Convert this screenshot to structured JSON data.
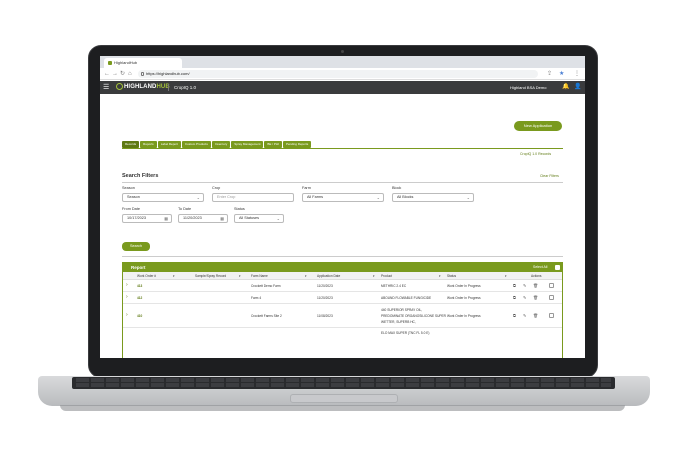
{
  "browser": {
    "tab_title": "HighlandHub",
    "url": "https://highlandhub.com/",
    "nav_icons": [
      "back-icon",
      "forward-icon",
      "reload-icon",
      "home-icon"
    ]
  },
  "header": {
    "logo_main": "HIGHLAND",
    "logo_accent": "HUB",
    "app_title": "CropIQ 1.0",
    "user": "Highland BSA Demo"
  },
  "toolbar": {
    "new_application": "New Application",
    "cropiq_label": "CropIQ 1.0 Records"
  },
  "tabs": [
    {
      "label": "Records",
      "active": true
    },
    {
      "label": "Reports",
      "active": false
    },
    {
      "label": "Label Report",
      "active": false
    },
    {
      "label": "Custom Products",
      "active": false
    },
    {
      "label": "Inventory",
      "active": false
    },
    {
      "label": "Spray Management",
      "active": false
    },
    {
      "label": "BE / PHI",
      "active": false
    },
    {
      "label": "Pending Reports",
      "active": false
    }
  ],
  "filters": {
    "title": "Search Filters",
    "clear": "Clear Filters",
    "season_label": "Season",
    "season_value": "Season",
    "crop_label": "Crop",
    "crop_placeholder": "Enter Crop",
    "farm_label": "Farm",
    "farm_value": "All Farms",
    "block_label": "Block",
    "block_value": "All Blocks",
    "from_label": "From Date",
    "from_value": "10/17/2023",
    "to_label": "To Date",
    "to_value": "11/20/2023",
    "status_label": "Status",
    "status_value": "All Statuses",
    "search_button": "Search"
  },
  "report": {
    "title": "Report",
    "select_all": "Select All",
    "columns": [
      "Work Order #",
      "Sample/Spray Record",
      "Farm Name",
      "Application Date",
      "Product",
      "Status",
      "Actions"
    ],
    "rows": [
      {
        "wo": "413",
        "farm": "Crockett Demo Farm",
        "date": "11/20/2023",
        "product": [
          "METHRIC 2.4 EC"
        ],
        "status": "Work Order In Progress"
      },
      {
        "wo": "412",
        "farm": "Farm 4",
        "date": "11/20/2023",
        "product": [
          "ABOUND FLOWABLE FUNGICIDE"
        ],
        "status": "Work Order In Progress"
      },
      {
        "wo": "410",
        "farm": "Crockett Farms Site 2",
        "date": "11/08/2023",
        "product": [
          "440 SUPERIOR SPRAY OIL,",
          "PREDOMINATE ORGANOSILICONE SUPER",
          "WETTER, SUPERB HC,"
        ],
        "status": "Work Order In Progress"
      },
      {
        "wo": "",
        "farm": "",
        "date": "",
        "product": [
          "ELO MAX SUPER (TNC FL 5.0 E)"
        ],
        "status": ""
      }
    ]
  },
  "colors": {
    "accent": "#7a9a1e",
    "accent_dark": "#5f7a13",
    "header_bg": "#3a3b3d"
  }
}
